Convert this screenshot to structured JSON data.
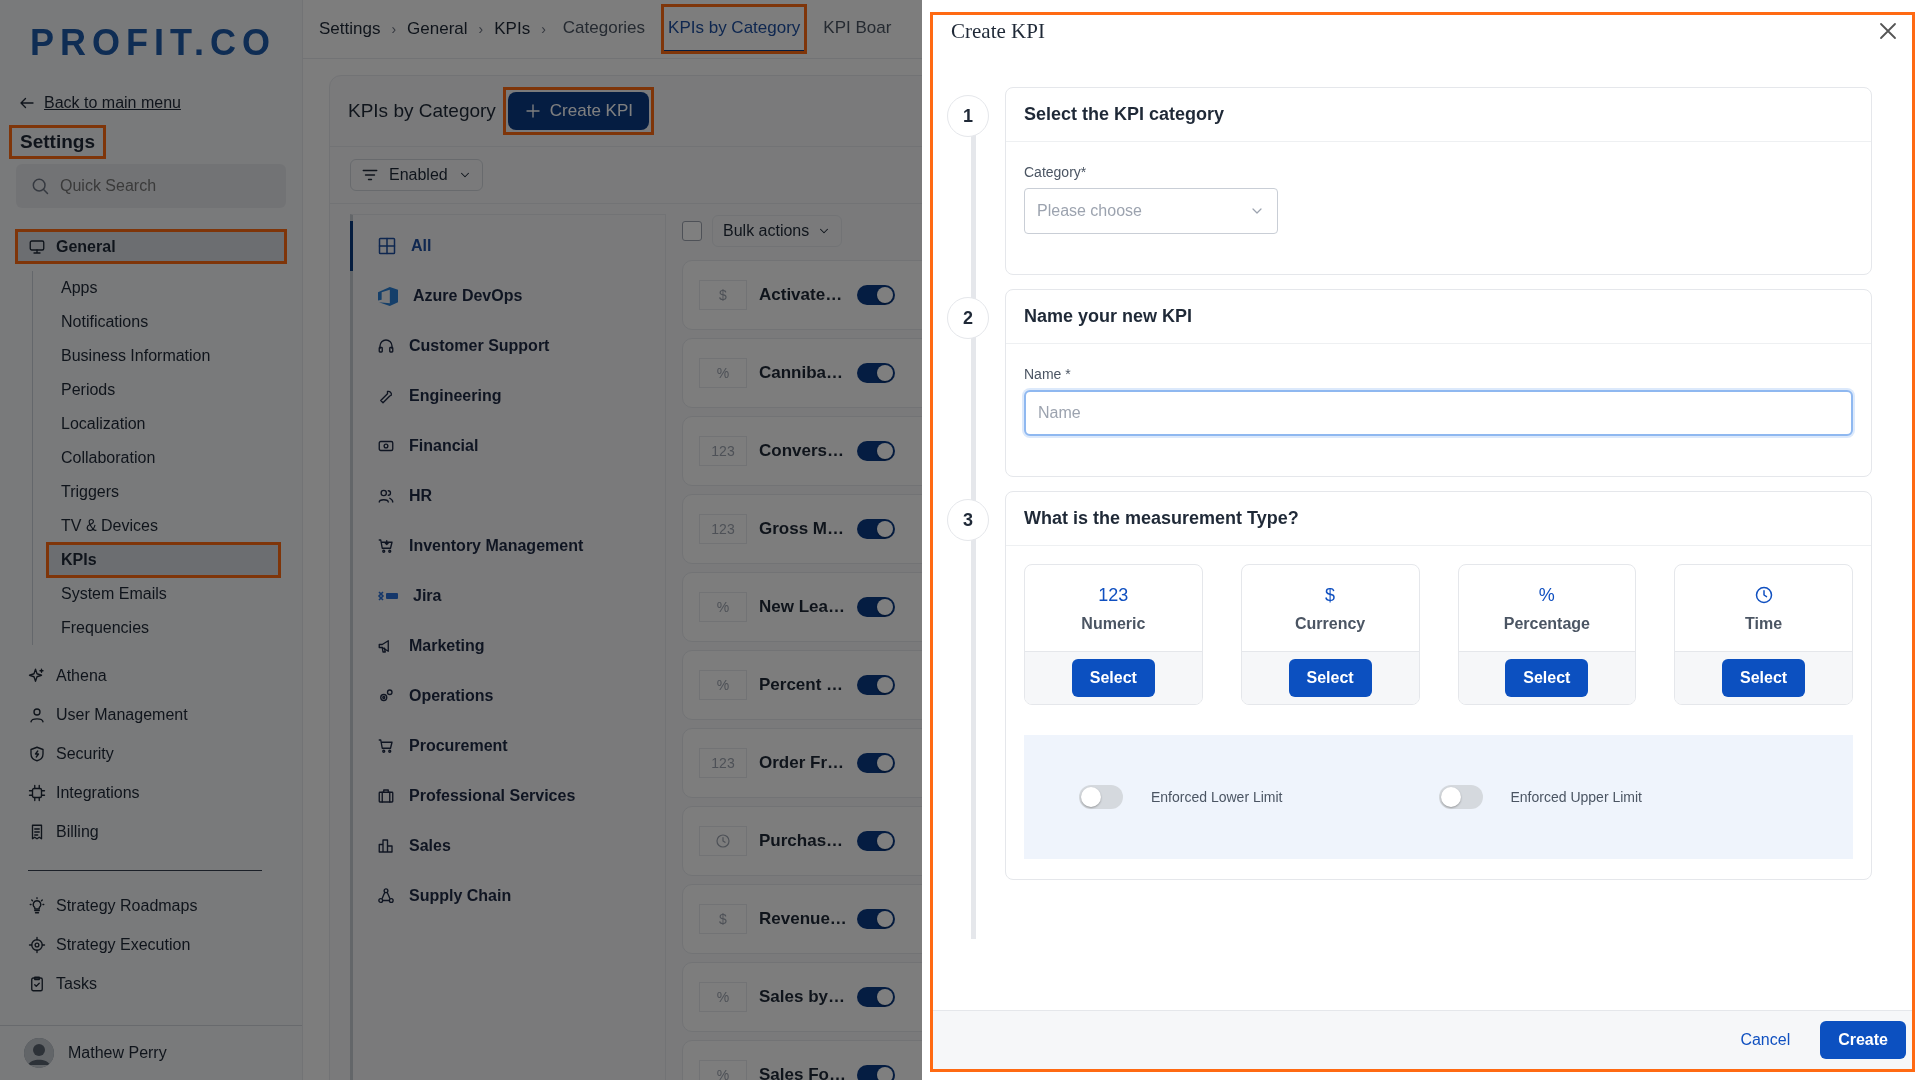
{
  "sidebar": {
    "logo": "PROFIT.CO",
    "back_link": "Back to main menu",
    "title": {
      "text": "Settings",
      "highlighted": true
    },
    "search": {
      "placeholder": "Quick Search"
    },
    "items": [
      {
        "label": "General",
        "selected": true,
        "highlighted": true,
        "children": [
          {
            "label": "Apps",
            "selected": false,
            "highlighted": false
          },
          {
            "label": "Notifications",
            "selected": false,
            "highlighted": false
          },
          {
            "label": "Business Information",
            "selected": false,
            "highlighted": false
          },
          {
            "label": "Periods",
            "selected": false,
            "highlighted": false
          },
          {
            "label": "Localization",
            "selected": false,
            "highlighted": false
          },
          {
            "label": "Collaboration",
            "selected": false,
            "highlighted": false
          },
          {
            "label": "Triggers",
            "selected": false,
            "highlighted": false
          },
          {
            "label": "TV & Devices",
            "selected": false,
            "highlighted": false
          },
          {
            "label": "KPIs",
            "selected": true,
            "highlighted": true
          },
          {
            "label": "System Emails",
            "selected": false,
            "highlighted": false
          },
          {
            "label": "Frequencies",
            "selected": false,
            "highlighted": false
          }
        ]
      },
      {
        "label": "Athena",
        "selected": false,
        "highlighted": false
      },
      {
        "label": "User Management",
        "selected": false,
        "highlighted": false
      },
      {
        "label": "Security",
        "selected": false,
        "highlighted": false
      },
      {
        "label": "Integrations",
        "selected": false,
        "highlighted": false
      },
      {
        "label": "Billing",
        "selected": false,
        "highlighted": false
      }
    ],
    "modules": [
      {
        "label": "Strategy Roadmaps"
      },
      {
        "label": "Strategy Execution"
      },
      {
        "label": "Tasks"
      }
    ],
    "user": {
      "name": "Mathew Perry"
    }
  },
  "breadcrumbs": [
    {
      "label": "Settings",
      "separator": "›"
    },
    {
      "label": "General",
      "separator": "›"
    },
    {
      "label": "KPIs",
      "separator": "›"
    }
  ],
  "tabs": [
    {
      "label": "Categories",
      "selected": false,
      "highlighted": false
    },
    {
      "label": "KPIs by Category",
      "selected": true,
      "highlighted": true
    },
    {
      "label": "KPI Boar",
      "selected": false,
      "highlighted": false
    }
  ],
  "panel": {
    "title": "KPIs by Category",
    "create_button": {
      "label": "Create KPI",
      "highlighted": true
    },
    "filter": "Enabled",
    "bulk_actions": "Bulk actions",
    "select_all_checked": false,
    "categories": [
      {
        "label": "All",
        "selected": true
      },
      {
        "label": "Azure DevOps",
        "selected": false
      },
      {
        "label": "Customer Support",
        "selected": false
      },
      {
        "label": "Engineering",
        "selected": false
      },
      {
        "label": "Financial",
        "selected": false
      },
      {
        "label": "HR",
        "selected": false
      },
      {
        "label": "Inventory Management",
        "selected": false
      },
      {
        "label": "Jira",
        "selected": false
      },
      {
        "label": "Marketing",
        "selected": false
      },
      {
        "label": "Operations",
        "selected": false
      },
      {
        "label": "Procurement",
        "selected": false
      },
      {
        "label": "Professional Services",
        "selected": false
      },
      {
        "label": "Sales",
        "selected": false
      },
      {
        "label": "Supply Chain",
        "selected": false
      }
    ],
    "kpis": [
      {
        "kind": "currency",
        "symbol": "$",
        "name": "Activate…",
        "on": true
      },
      {
        "kind": "percentage",
        "symbol": "%",
        "name": "Canniba…",
        "on": true
      },
      {
        "kind": "numeric",
        "symbol": "123",
        "name": "Convers…",
        "on": true
      },
      {
        "kind": "numeric",
        "symbol": "123",
        "name": "Gross M…",
        "on": true
      },
      {
        "kind": "percentage",
        "symbol": "%",
        "name": "New Lea…",
        "on": true
      },
      {
        "kind": "percentage",
        "symbol": "%",
        "name": "Percent …",
        "on": true
      },
      {
        "kind": "numeric",
        "symbol": "123",
        "name": "Order Fr…",
        "on": true
      },
      {
        "kind": "time",
        "name": "Purchas…",
        "on": true
      },
      {
        "kind": "currency",
        "symbol": "$",
        "name": "Revenue…",
        "on": true
      },
      {
        "kind": "percentage",
        "symbol": "%",
        "name": "Sales by…",
        "on": true
      },
      {
        "kind": "percentage",
        "symbol": "%",
        "name": "Sales Fo…",
        "on": true
      }
    ]
  },
  "dialog": {
    "title": "Create KPI",
    "highlighted": true,
    "steps": [
      {
        "number": "1",
        "title": "Select the KPI category",
        "kind": "select",
        "label": "Category*",
        "placeholder": "Please choose"
      },
      {
        "number": "2",
        "title": "Name your new KPI",
        "kind": "text",
        "label": "Name *",
        "placeholder": "Name"
      },
      {
        "number": "3",
        "title": "What is the measurement Type?",
        "kind": "types",
        "types": [
          {
            "kind": "numeric",
            "symbol": "123",
            "label": "Numeric",
            "button": "Select"
          },
          {
            "kind": "currency",
            "symbol": "$",
            "label": "Currency",
            "button": "Select"
          },
          {
            "kind": "percentage",
            "symbol": "%",
            "label": "Percentage",
            "button": "Select"
          },
          {
            "kind": "time",
            "label": "Time",
            "button": "Select"
          }
        ],
        "limits": [
          {
            "label": "Enforced Lower Limit",
            "on": false
          },
          {
            "label": "Enforced Upper Limit",
            "on": false
          }
        ]
      }
    ],
    "buttons": [
      {
        "kind": "secondary",
        "label": "Cancel"
      },
      {
        "kind": "primary",
        "label": "Create"
      }
    ]
  }
}
